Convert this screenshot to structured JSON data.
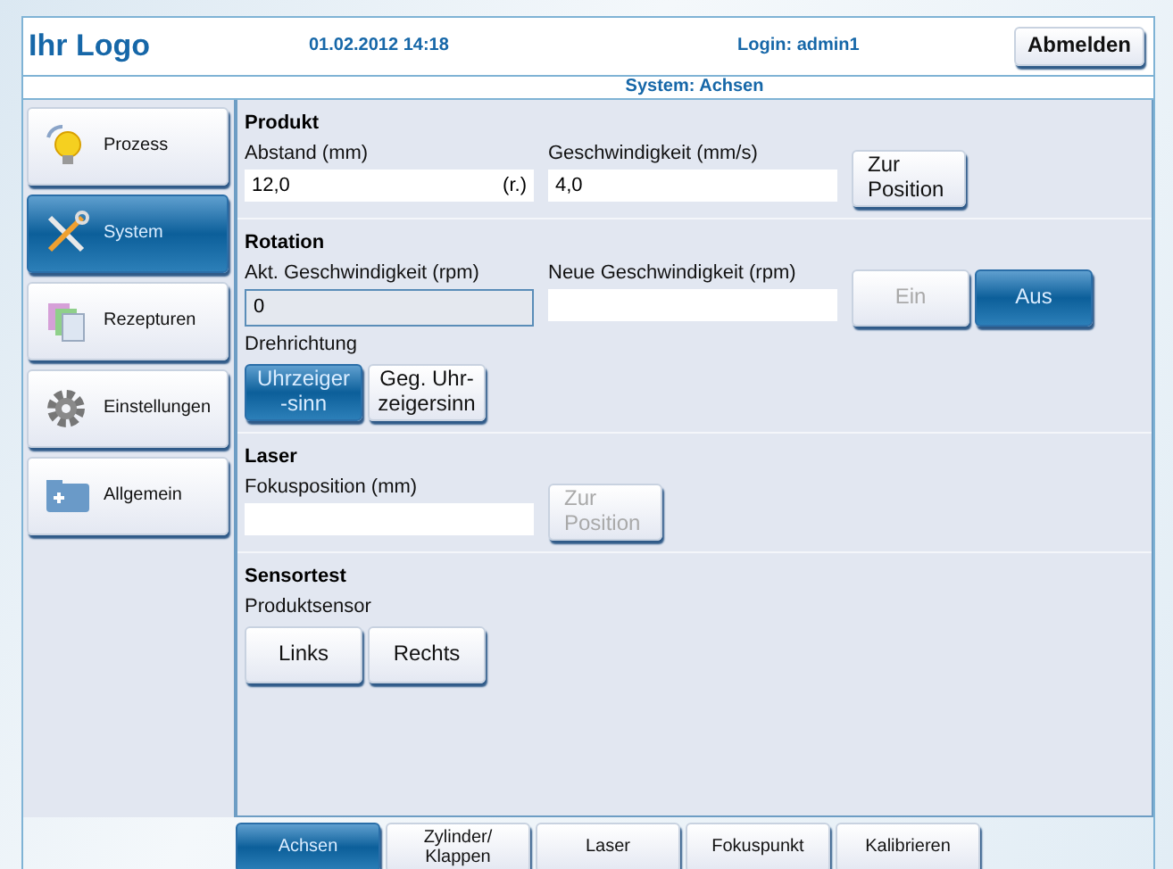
{
  "header": {
    "logo": "Ihr Logo",
    "datetime": "01.02.2012 14:18",
    "login": "Login: admin1",
    "logout_button": "Abmelden"
  },
  "title": "System: Achsen",
  "sidebar": {
    "items": [
      {
        "label": "Prozess",
        "selected": false
      },
      {
        "label": "System",
        "selected": true
      },
      {
        "label": "Rezepturen",
        "selected": false
      },
      {
        "label": "Einstellungen",
        "selected": false
      },
      {
        "label": "Allgemein",
        "selected": false
      }
    ]
  },
  "sections": [
    {
      "title": "Produkt",
      "rows": [
        {
          "items": [
            {
              "kind": "field",
              "label": "Abstand (mm)",
              "value": "12,0",
              "suffix": "(r.)",
              "readonly": false
            },
            {
              "kind": "field",
              "label": "Geschwindigkeit (mm/s)",
              "value": "4,0",
              "readonly": false
            },
            {
              "kind": "button",
              "label": "Zur\nPosition",
              "selected": false,
              "disabled": false
            }
          ]
        }
      ]
    },
    {
      "title": "Rotation",
      "rows": [
        {
          "items": [
            {
              "kind": "field",
              "label": "Akt. Geschwindigkeit (rpm)",
              "value": "0",
              "readonly": true
            },
            {
              "kind": "field",
              "label": "Neue Geschwindigkeit (rpm)",
              "readonly": false
            },
            {
              "kind": "group",
              "buttons": [
                {
                  "label": "Ein",
                  "selected": false,
                  "disabled": true
                },
                {
                  "label": "Aus",
                  "selected": true,
                  "disabled": false
                }
              ]
            }
          ]
        },
        {
          "items": [
            {
              "kind": "group",
              "label": "Drehrichtung",
              "buttons": [
                {
                  "label": "Uhrzeiger\n-sinn",
                  "selected": true,
                  "disabled": false
                },
                {
                  "label": "Geg. Uhr-\nzeigersinn",
                  "selected": false,
                  "disabled": false
                }
              ]
            }
          ]
        }
      ]
    },
    {
      "title": "Laser",
      "rows": [
        {
          "items": [
            {
              "kind": "field",
              "label": "Fokusposition (mm)",
              "readonly": false
            },
            {
              "kind": "button",
              "label": "Zur\nPosition",
              "selected": false,
              "disabled": true
            }
          ]
        }
      ]
    },
    {
      "title": "Sensortest",
      "rows": [
        {
          "items": [
            {
              "kind": "group",
              "label": "Produktsensor",
              "buttons": [
                {
                  "label": "Links",
                  "selected": false,
                  "disabled": false
                },
                {
                  "label": "Rechts",
                  "selected": false,
                  "disabled": false
                }
              ]
            }
          ]
        }
      ]
    }
  ],
  "tabs": [
    {
      "label": "Achsen",
      "selected": true
    },
    {
      "label": "Zylinder/\nKlappen",
      "selected": false
    },
    {
      "label": "Laser",
      "selected": false
    },
    {
      "label": "Fokuspunkt",
      "selected": false
    },
    {
      "label": "Kalibrieren",
      "selected": false
    }
  ]
}
